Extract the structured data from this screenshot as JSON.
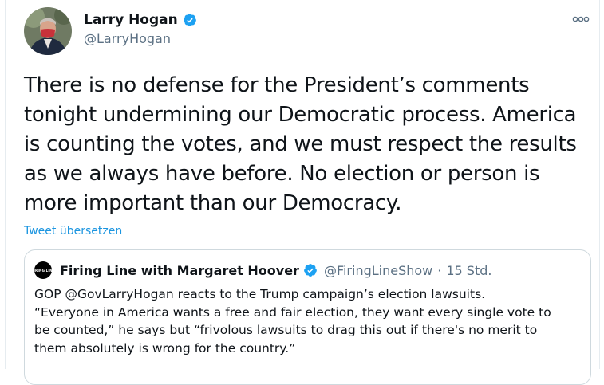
{
  "tweet": {
    "display_name": "Larry Hogan",
    "handle": "@LarryHogan",
    "verified_icon": "verified-badge-icon",
    "more_icon": "more-options-icon",
    "text": "There is no defense for the President’s comments\ntonight undermining our Democratic process. America\nis counting the votes, and we must respect the results\nas we always have before. No election or person is\nmore important than our Democracy.",
    "translate_label": "Tweet übersetzen"
  },
  "quoted_tweet": {
    "display_name": "Firing Line with Margaret Hoover",
    "handle": "@FiringLineShow",
    "separator": "·",
    "time": "15 Std.",
    "avatar_text": "FIRING LINE",
    "text": "GOP @GovLarryHogan reacts to the Trump campaign’s election lawsuits.\n“Everyone in America wants a free and fair election, they want every single vote to\nbe counted,” he says but “frivolous lawsuits to drag this out if there's no merit to\nthem absolutely is wrong for the country.”"
  },
  "colors": {
    "verified": "#1da1f2",
    "link": "#1b95e0",
    "secondary_text": "#5b7083",
    "border": "#cfd9de"
  }
}
